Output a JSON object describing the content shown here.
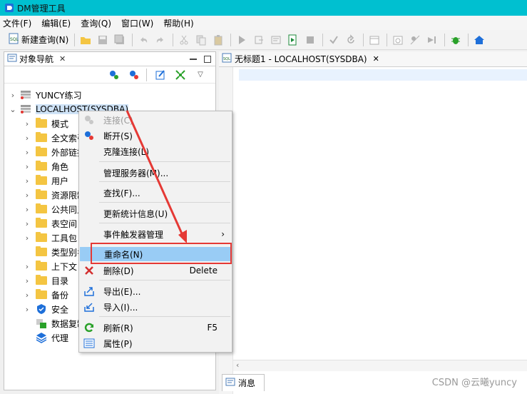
{
  "window": {
    "title": "DM管理工具"
  },
  "menu": [
    "文件(F)",
    "编辑(E)",
    "查询(Q)",
    "窗口(W)",
    "帮助(H)"
  ],
  "toolbar": {
    "new_query": "新建查询(N)"
  },
  "left_panel": {
    "tab_label": "对象导航",
    "close_glyph": "✕"
  },
  "tree": {
    "connections": [
      {
        "label": "YUNCY练习",
        "expanded": false
      },
      {
        "label": "LOCALHOST(SYSDBA)",
        "expanded": true
      }
    ],
    "children": [
      {
        "label": "模式",
        "icon": "folder-icon",
        "expandable": true
      },
      {
        "label": "全文索引",
        "icon": "folder-icon",
        "expandable": true
      },
      {
        "label": "外部链接",
        "icon": "folder-icon",
        "expandable": true
      },
      {
        "label": "角色",
        "icon": "folder-icon",
        "expandable": true
      },
      {
        "label": "用户",
        "icon": "folder-icon",
        "expandable": true
      },
      {
        "label": "资源限制",
        "icon": "folder-icon",
        "expandable": true
      },
      {
        "label": "公共同义",
        "icon": "folder-icon",
        "expandable": true
      },
      {
        "label": "表空间",
        "icon": "folder-icon",
        "expandable": true
      },
      {
        "label": "工具包",
        "icon": "folder-icon",
        "expandable": true
      },
      {
        "label": "类型别名",
        "icon": "folder-icon",
        "expandable": false
      },
      {
        "label": "上下文",
        "icon": "folder-icon",
        "expandable": true
      },
      {
        "label": "目录",
        "icon": "folder-icon",
        "expandable": true
      },
      {
        "label": "备份",
        "icon": "folder-icon",
        "expandable": true
      },
      {
        "label": "安全",
        "icon": "shield-icon",
        "expandable": true
      },
      {
        "label": "数据复制",
        "icon": "replication-icon",
        "expandable": false
      },
      {
        "label": "代理",
        "icon": "stack-icon",
        "expandable": false
      }
    ]
  },
  "editor": {
    "tab_label": "无标题1 - LOCALHOST(SYSDBA)",
    "close_glyph": "✕"
  },
  "message_tab": {
    "label": "消息"
  },
  "context_menu": {
    "items": [
      {
        "label": "连接(C)",
        "disabled": true,
        "icon": "connect-icon"
      },
      {
        "label": "断开(S)",
        "icon": "disconnect-icon"
      },
      {
        "label": "克隆连接(L)"
      },
      {
        "label": "管理服务器(M)..."
      },
      {
        "label": "查找(F)..."
      },
      {
        "label": "更新统计信息(U)"
      },
      {
        "label": "事件触发器管理",
        "submenu": true
      },
      {
        "label": "重命名(N)",
        "highlighted": true
      },
      {
        "label": "删除(D)",
        "shortcut": "Delete",
        "icon": "delete-icon"
      },
      {
        "label": "导出(E)...",
        "icon": "export-icon"
      },
      {
        "label": "导入(I)...",
        "icon": "import-icon"
      },
      {
        "label": "刷新(R)",
        "shortcut": "F5",
        "icon": "refresh-icon"
      },
      {
        "label": "属性(P)",
        "icon": "properties-icon"
      }
    ],
    "submenu_arrow": "›"
  },
  "watermark": "CSDN @云曦yuncy",
  "colors": {
    "titlebar": "#00c0d0",
    "highlight": "#99ccf5",
    "annotation": "#e53935",
    "folder": "#f4c542"
  }
}
